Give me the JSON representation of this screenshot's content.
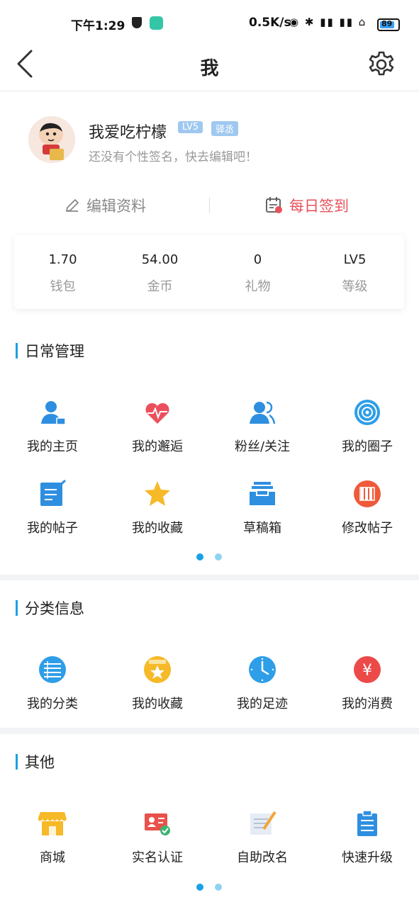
{
  "status_bar": {
    "time": "下午1:29",
    "speed": "0.5K/s",
    "battery": "89"
  },
  "header": {
    "title": "我"
  },
  "profile": {
    "name": "我爱吃柠檬",
    "level_badge": "LV5",
    "title_badge": "驿丞",
    "signature": "还没有个性签名，快去编辑吧！",
    "edit_label": "编辑资料",
    "checkin_label": "每日签到"
  },
  "stats": [
    {
      "value": "1.70",
      "label": "钱包"
    },
    {
      "value": "54.00",
      "label": "金币"
    },
    {
      "value": "0",
      "label": "礼物"
    },
    {
      "value": "LV5",
      "label": "等级"
    }
  ],
  "daily": {
    "title": "日常管理",
    "items": [
      {
        "label": "我的主页",
        "icon": "user-home-icon"
      },
      {
        "label": "我的邂逅",
        "icon": "heartbeat-icon"
      },
      {
        "label": "粉丝/关注",
        "icon": "followers-icon"
      },
      {
        "label": "我的圈子",
        "icon": "circle-target-icon"
      },
      {
        "label": "我的帖子",
        "icon": "post-edit-icon"
      },
      {
        "label": "我的收藏",
        "icon": "star-icon"
      },
      {
        "label": "草稿箱",
        "icon": "drafts-tray-icon"
      },
      {
        "label": "修改帖子",
        "icon": "edit-post-icon"
      }
    ]
  },
  "category": {
    "title": "分类信息",
    "items": [
      {
        "label": "我的分类",
        "icon": "list-circle-icon"
      },
      {
        "label": "我的收藏",
        "icon": "star-box-icon"
      },
      {
        "label": "我的足迹",
        "icon": "clock-icon"
      },
      {
        "label": "我的消费",
        "icon": "yen-icon"
      }
    ]
  },
  "other": {
    "title": "其他",
    "items": [
      {
        "label": "商城",
        "icon": "shop-icon"
      },
      {
        "label": "实名认证",
        "icon": "id-card-icon"
      },
      {
        "label": "自助改名",
        "icon": "rename-paper-icon"
      },
      {
        "label": "快速升级",
        "icon": "clipboard-icon"
      }
    ]
  },
  "colors": {
    "accent": "#1aa0e0",
    "checkin": "#e8525b",
    "badge": "#9fc8f0"
  }
}
